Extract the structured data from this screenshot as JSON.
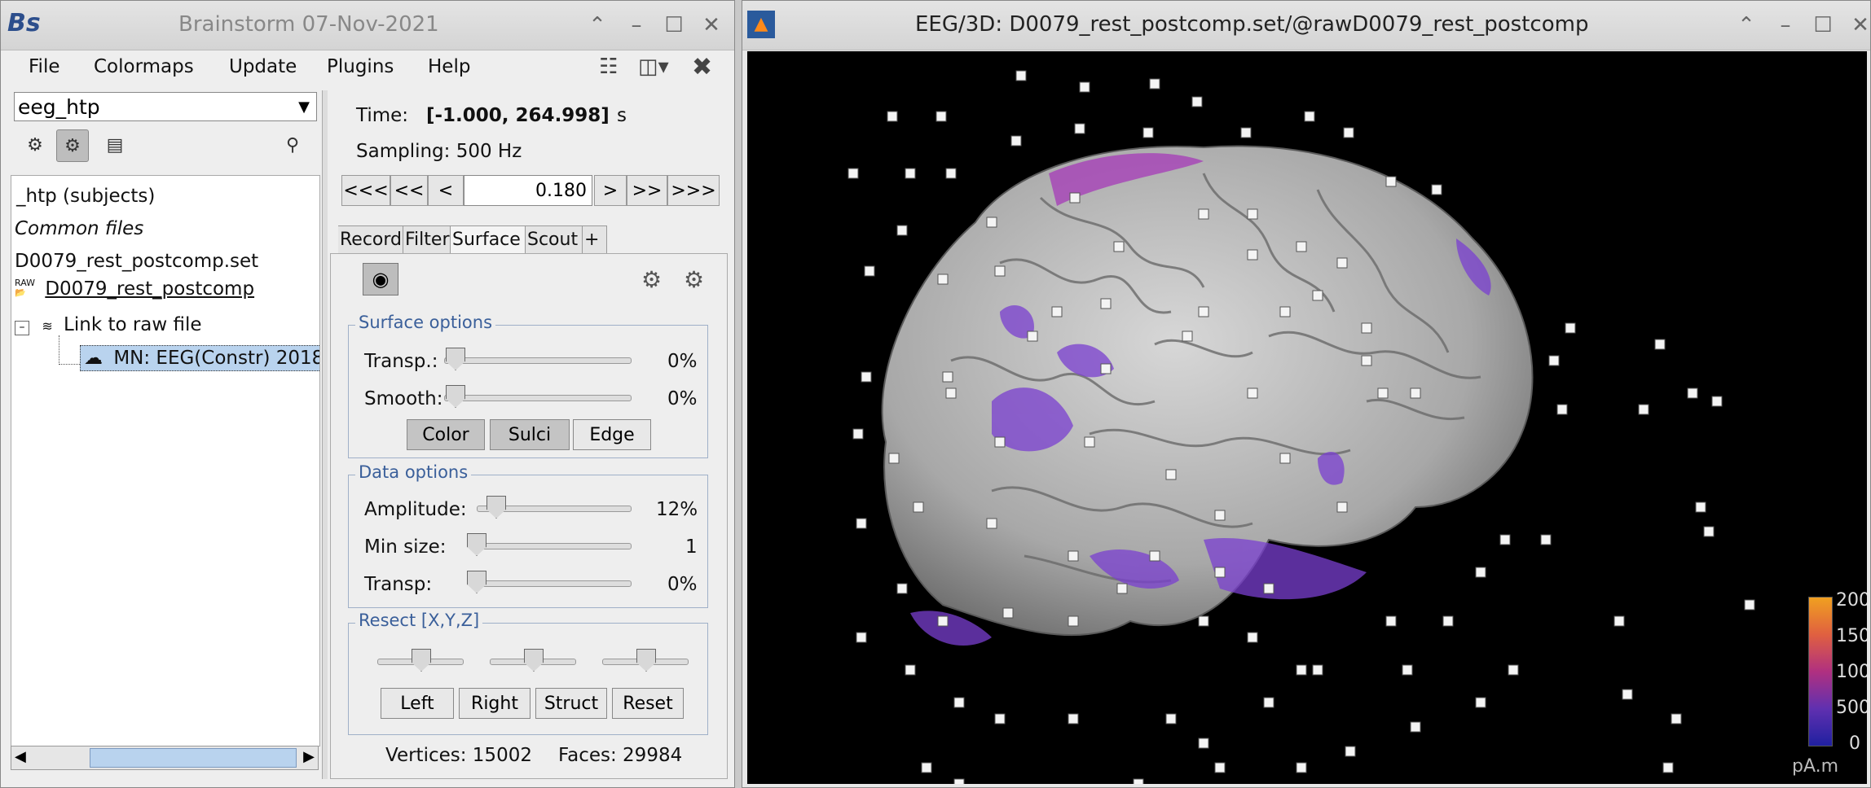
{
  "bs_window": {
    "title": "Brainstorm 07-Nov-2021",
    "menus": [
      "File",
      "Colormaps",
      "Update",
      "Plugins",
      "Help"
    ],
    "protocol": "eeg_htp",
    "tree": {
      "subjects": "_htp (subjects)",
      "common_files": "Common files",
      "set_file": "D0079_rest_postcomp.set",
      "raw_badge": "RAW",
      "raw_folder": "D0079_rest_postcomp",
      "link": "Link to raw file",
      "source": "MN: EEG(Constr) 2018"
    }
  },
  "time_panel": {
    "time_label": "Time:",
    "time_range": "[-1.000, 264.998]",
    "time_unit": "s",
    "sampling": "Sampling: 500 Hz",
    "nav": [
      "<<<",
      "<<",
      "<",
      ">",
      ">>",
      ">>>"
    ],
    "current_time": "0.180"
  },
  "tabs": [
    "Record",
    "Filter",
    "Surface",
    "Scout",
    "+"
  ],
  "surface_options": {
    "title": "Surface options",
    "transp_label": "Transp.:",
    "transp_value": "0%",
    "smooth_label": "Smooth:",
    "smooth_value": "0%",
    "buttons": [
      "Color",
      "Sulci",
      "Edge"
    ]
  },
  "data_options": {
    "title": "Data options",
    "amplitude_label": "Amplitude:",
    "amplitude_value": "12%",
    "minsize_label": "Min size:",
    "minsize_value": "1",
    "transp_label": "Transp:",
    "transp_value": "0%"
  },
  "resect": {
    "title": "Resect [X,Y,Z]",
    "buttons": [
      "Left",
      "Right",
      "Struct",
      "Reset"
    ]
  },
  "stats": {
    "vertices": "Vertices: 15002",
    "faces": "Faces: 29984"
  },
  "eeg_window": {
    "title": "EEG/3D: D0079_rest_postcomp.set/@rawD0079_rest_postcomp",
    "colorbar_ticks": [
      "200",
      "150",
      "100",
      "500",
      "0"
    ],
    "colorbar_unit": "pA.m"
  }
}
